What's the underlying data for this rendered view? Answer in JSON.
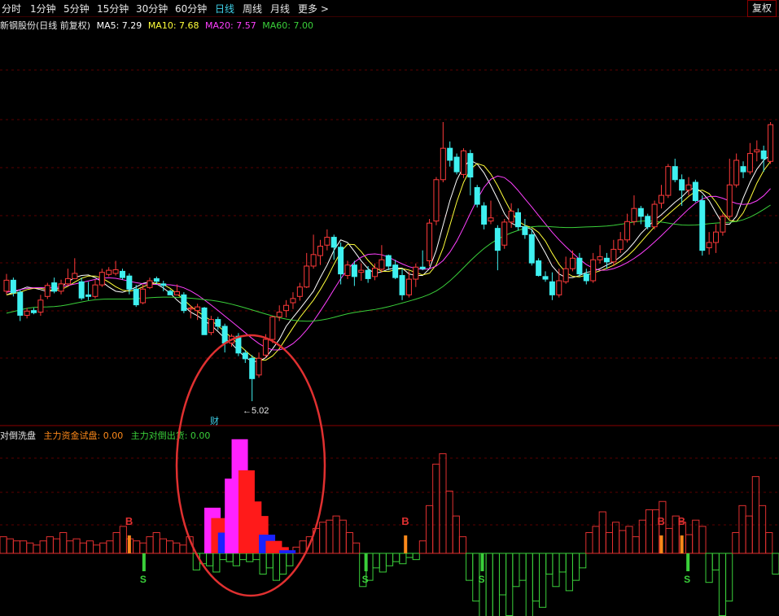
{
  "toolbar": {
    "tabs": [
      {
        "label": "分时"
      },
      {
        "label": "1分钟"
      },
      {
        "label": "5分钟"
      },
      {
        "label": "15分钟"
      },
      {
        "label": "30分钟"
      },
      {
        "label": "60分钟"
      },
      {
        "label": "日线"
      },
      {
        "label": "周线"
      },
      {
        "label": "月线"
      },
      {
        "label": "更多 >"
      }
    ],
    "active_tab": "日线",
    "adjust_button": "复权"
  },
  "main_chart": {
    "title": "新钢股份(日线 前复权)",
    "ma_legend": [
      {
        "label": "MA5: 7.29",
        "color": "#ffffff"
      },
      {
        "label": "MA10: 7.68",
        "color": "#ffff3a"
      },
      {
        "label": "MA20: 7.57",
        "color": "#ff40ff"
      },
      {
        "label": "MA60: 7.00",
        "color": "#3ad03a"
      }
    ],
    "low_marker": "5.02",
    "event_marker": "财"
  },
  "indicator": {
    "name": "对倒洗盘",
    "legend": [
      {
        "label": "主力资金试盘: 0.00",
        "color": "#ff8a1a"
      },
      {
        "label": "主力对倒出货: 0.00",
        "color": "#3ad03a"
      }
    ],
    "signal_buy": "B",
    "signal_sell": "S"
  },
  "colors": {
    "up": "#ff3a3a",
    "down": "#3ff0f0",
    "grid": "#5a0000",
    "annotation": "#e03030"
  },
  "candles": [
    [
      7.12,
      7.33,
      7.45,
      7.06
    ],
    [
      7.33,
      7.09,
      7.38,
      7.02
    ],
    [
      7.1,
      6.66,
      7.15,
      6.55
    ],
    [
      6.66,
      6.74,
      6.8,
      6.6
    ],
    [
      6.75,
      6.71,
      6.8,
      6.68
    ],
    [
      6.72,
      6.95,
      7.05,
      6.65
    ],
    [
      7.02,
      7.23,
      7.28,
      6.97
    ],
    [
      7.28,
      7.12,
      7.38,
      7.08
    ],
    [
      7.12,
      7.26,
      7.34,
      7.06
    ],
    [
      7.26,
      7.36,
      7.55,
      7.22
    ],
    [
      7.36,
      7.46,
      7.75,
      7.36
    ],
    [
      7.3,
      6.99,
      7.38,
      6.95
    ],
    [
      7.05,
      7.02,
      7.3,
      6.95
    ],
    [
      7.02,
      7.24,
      7.34,
      6.98
    ],
    [
      7.24,
      7.48,
      7.55,
      7.2
    ],
    [
      7.44,
      7.52,
      7.58,
      7.4
    ],
    [
      7.46,
      7.53,
      7.7,
      7.42
    ],
    [
      7.5,
      7.38,
      7.55,
      7.34
    ],
    [
      7.41,
      7.16,
      7.46,
      7.06
    ],
    [
      7.16,
      6.86,
      7.24,
      6.82
    ],
    [
      6.9,
      7.16,
      7.25,
      6.87
    ],
    [
      7.19,
      7.32,
      7.38,
      7.16
    ],
    [
      7.36,
      7.31,
      7.4,
      7.25
    ],
    [
      7.26,
      7.23,
      7.32,
      7.12
    ],
    [
      7.12,
      7.05,
      7.15,
      7.05
    ],
    [
      7.05,
      7.11,
      7.25,
      7.05
    ],
    [
      7.05,
      6.75,
      7.1,
      6.7
    ],
    [
      6.78,
      6.8,
      6.85,
      6.6
    ],
    [
      6.75,
      6.82,
      6.88,
      6.57
    ],
    [
      6.8,
      6.29,
      6.82,
      6.29
    ],
    [
      6.33,
      6.58,
      6.65,
      6.28
    ],
    [
      6.58,
      6.45,
      6.63,
      6.38
    ],
    [
      6.45,
      6.13,
      6.5,
      5.95
    ],
    [
      6.13,
      6.26,
      6.3,
      6.06
    ],
    [
      6.26,
      5.94,
      6.32,
      5.88
    ],
    [
      5.94,
      5.83,
      6.0,
      5.75
    ],
    [
      5.84,
      5.45,
      5.9,
      5.02
    ],
    [
      5.52,
      5.84,
      5.95,
      5.47
    ],
    [
      5.9,
      6.2,
      6.3,
      5.85
    ],
    [
      6.2,
      6.63,
      6.65,
      6.13
    ],
    [
      6.63,
      6.72,
      6.85,
      6.55
    ],
    [
      6.75,
      6.85,
      6.95,
      6.62
    ],
    [
      6.9,
      6.98,
      7.1,
      6.78
    ],
    [
      7.02,
      7.2,
      7.28,
      6.94
    ],
    [
      7.2,
      7.6,
      7.85,
      7.18
    ],
    [
      7.6,
      7.82,
      8.2,
      7.55
    ],
    [
      7.8,
      7.98,
      8.1,
      7.62
    ],
    [
      8.0,
      8.15,
      8.3,
      7.9
    ],
    [
      8.15,
      7.96,
      8.2,
      7.72
    ],
    [
      7.96,
      7.45,
      8.05,
      7.25
    ],
    [
      7.42,
      7.62,
      7.7,
      7.35
    ],
    [
      7.62,
      7.4,
      7.7,
      7.22
    ],
    [
      7.48,
      7.52,
      7.65,
      7.32
    ],
    [
      7.52,
      7.36,
      7.6,
      7.28
    ],
    [
      7.4,
      7.56,
      7.65,
      7.33
    ],
    [
      7.54,
      7.72,
      8.0,
      7.48
    ],
    [
      7.8,
      7.6,
      7.82,
      7.52
    ],
    [
      7.62,
      7.38,
      7.72,
      7.35
    ],
    [
      7.42,
      7.05,
      7.55,
      6.95
    ],
    [
      7.05,
      7.35,
      7.5,
      7.0
    ],
    [
      7.35,
      7.58,
      7.65,
      7.2
    ],
    [
      7.58,
      7.55,
      7.9,
      7.52
    ],
    [
      7.7,
      8.42,
      8.5,
      7.6
    ],
    [
      8.46,
      9.25,
      9.3,
      8.38
    ],
    [
      9.25,
      9.85,
      10.35,
      9.2
    ],
    [
      9.85,
      9.62,
      9.98,
      9.5
    ],
    [
      9.68,
      9.4,
      9.75,
      9.35
    ],
    [
      9.35,
      9.8,
      9.85,
      9.28
    ],
    [
      9.75,
      9.3,
      9.82,
      8.95
    ],
    [
      9.1,
      8.78,
      9.15,
      8.72
    ],
    [
      8.75,
      8.4,
      8.82,
      8.3
    ],
    [
      8.46,
      8.52,
      8.85,
      8.4
    ],
    [
      8.32,
      7.9,
      8.38,
      7.52
    ],
    [
      8.0,
      8.44,
      8.5,
      7.93
    ],
    [
      8.44,
      8.65,
      8.8,
      8.33
    ],
    [
      8.62,
      8.35,
      8.7,
      8.28
    ],
    [
      8.35,
      8.2,
      8.5,
      8.12
    ],
    [
      8.2,
      7.66,
      8.3,
      7.61
    ],
    [
      7.7,
      7.42,
      7.75,
      7.4
    ],
    [
      7.4,
      7.35,
      7.5,
      7.3
    ],
    [
      7.3,
      7.05,
      7.48,
      6.95
    ],
    [
      7.05,
      7.32,
      7.55,
      7.0
    ],
    [
      7.3,
      7.55,
      7.78,
      7.26
    ],
    [
      7.55,
      7.75,
      7.9,
      7.5
    ],
    [
      7.75,
      7.45,
      7.85,
      7.4
    ],
    [
      7.45,
      7.32,
      7.55,
      7.25
    ],
    [
      7.32,
      7.72,
      7.85,
      7.28
    ],
    [
      7.72,
      7.78,
      8.0,
      7.65
    ],
    [
      7.75,
      7.68,
      7.85,
      7.55
    ],
    [
      7.68,
      7.92,
      8.1,
      7.6
    ],
    [
      7.92,
      8.1,
      8.25,
      7.85
    ],
    [
      8.1,
      8.45,
      8.6,
      8.05
    ],
    [
      8.45,
      8.7,
      8.95,
      8.38
    ],
    [
      8.7,
      8.55,
      8.75,
      8.4
    ],
    [
      8.55,
      8.35,
      8.6,
      8.3
    ],
    [
      8.35,
      8.78,
      8.85,
      8.3
    ],
    [
      8.8,
      8.95,
      9.15,
      8.7
    ],
    [
      8.95,
      9.5,
      9.55,
      8.9
    ],
    [
      9.5,
      9.25,
      9.65,
      9.2
    ],
    [
      9.25,
      9.05,
      9.35,
      8.75
    ],
    [
      9.05,
      9.15,
      9.3,
      8.95
    ],
    [
      9.2,
      8.85,
      9.25,
      8.82
    ],
    [
      8.85,
      7.9,
      8.95,
      7.8
    ],
    [
      7.95,
      8.05,
      8.25,
      7.82
    ],
    [
      8.05,
      8.25,
      8.4,
      7.85
    ],
    [
      8.25,
      8.55,
      8.6,
      8.18
    ],
    [
      8.55,
      9.15,
      9.65,
      8.5
    ],
    [
      9.15,
      9.62,
      9.75,
      9.1
    ],
    [
      9.5,
      9.4,
      9.6,
      9.28
    ],
    [
      9.4,
      9.75,
      9.95,
      9.35
    ],
    [
      9.78,
      9.82,
      10.0,
      9.6
    ],
    [
      9.8,
      9.65,
      9.9,
      9.4
    ],
    [
      9.6,
      10.3,
      10.35,
      9.55
    ]
  ],
  "ma_values": {
    "ma5": [
      7.05,
      7.1,
      7.15,
      7.2,
      7.18,
      7.15,
      7.11,
      7.14,
      7.2,
      7.3,
      7.38,
      7.42,
      7.43,
      7.38,
      7.3,
      7.2,
      7.12,
      7.1,
      7.14,
      7.2,
      7.27,
      7.3,
      7.26,
      7.18,
      7.08,
      6.95,
      6.84,
      6.72,
      6.65,
      6.56,
      6.47,
      6.35,
      6.22,
      6.12,
      5.98,
      5.86,
      5.78,
      5.78,
      5.85,
      6.02,
      6.2,
      6.45,
      6.62,
      6.78,
      6.95,
      7.12,
      7.38,
      7.62,
      7.9,
      8.1,
      8.05,
      7.88,
      7.7,
      7.55,
      7.46,
      7.49,
      7.54,
      7.56,
      7.56,
      7.45,
      7.42,
      7.42,
      7.55,
      7.9,
      8.38,
      8.85,
      9.24,
      9.5,
      9.62,
      9.55,
      9.38,
      9.14,
      8.88,
      8.6,
      8.42,
      8.36,
      8.35,
      8.3,
      8.08,
      7.85,
      7.6,
      7.45,
      7.38,
      7.38,
      7.42,
      7.48,
      7.5,
      7.55,
      7.62,
      7.68,
      7.78,
      7.9,
      8.05,
      8.22,
      8.35,
      8.48,
      8.58,
      8.7,
      8.82,
      8.92,
      9.05,
      9.1,
      9.0,
      8.85,
      8.62,
      8.4,
      8.4,
      8.55,
      8.9,
      9.2,
      9.45,
      9.62,
      9.72
    ]
  },
  "indicator_bars": {
    "hollow": [
      0.8,
      0.7,
      0.6,
      0.6,
      0.5,
      0.4,
      0.6,
      0.8,
      0.7,
      1.0,
      0.6,
      0.7,
      0.5,
      0.6,
      0.4,
      0.5,
      0.6,
      1.0,
      1.3,
      0.7,
      0.6,
      0.5,
      0.8,
      1.0,
      0.7,
      0.6,
      0.5,
      0.4,
      0.8,
      -0.8,
      -0.5,
      -0.6,
      -0.9,
      -0.3,
      -0.4,
      -0.6,
      -0.3,
      -0.4,
      -0.3,
      -1.0,
      -0.7,
      -1.3,
      -1.0,
      -0.6,
      0.3,
      0.6,
      0.8,
      1.2,
      1.5,
      1.6,
      1.8,
      1.6,
      1.0,
      0.5,
      -1.6,
      -1.3,
      -0.7,
      -0.9,
      -0.6,
      -0.4,
      -0.5,
      -0.2,
      -0.3,
      0.6,
      2.3,
      4.3,
      4.8,
      3.0,
      1.8,
      0.8,
      -1.3,
      -2.3,
      -3.3,
      -4.4,
      -3.6,
      -2.0,
      -3.0,
      -1.6,
      -1.3,
      -3.6,
      -2.3,
      -2.6,
      -1.0,
      -1.6,
      -0.9,
      -1.8,
      -1.3,
      -0.7,
      1.0,
      1.3,
      2.0,
      1.0,
      1.5,
      1.1,
      1.3,
      0.8,
      1.6,
      2.1,
      2.1,
      2.5,
      1.2,
      1.8,
      1.5,
      0.9,
      1.6,
      1.3,
      -1.4,
      -0.8,
      -3.0,
      -2.3,
      1.0,
      2.3,
      1.8,
      3.7,
      2.3,
      1.0,
      -1.0
    ]
  },
  "indicator_solid": [
    {
      "i": 20,
      "v": 2.2,
      "c": "m"
    },
    {
      "i": 21,
      "v": 1.7,
      "c": "r"
    },
    {
      "i": 22,
      "v": 1.0,
      "c": "b"
    },
    {
      "i": 23,
      "v": 3.6,
      "c": "m"
    },
    {
      "i": 24,
      "v": 5.5,
      "c": "m"
    },
    {
      "i": 25,
      "v": 4.0,
      "c": "r"
    },
    {
      "i": 26,
      "v": 2.5,
      "c": "r"
    },
    {
      "i": 27,
      "v": 1.8,
      "c": "r"
    },
    {
      "i": 28,
      "v": 0.9,
      "c": "b"
    },
    {
      "i": 29,
      "v": 0.6,
      "c": "r"
    },
    {
      "i": 30,
      "v": 0.3,
      "c": "r"
    },
    {
      "i": 31,
      "v": 0.15,
      "c": "b"
    }
  ],
  "buy_signals": [
    12,
    39,
    56,
    58,
    75
  ],
  "sell_signals": [
    13,
    34,
    45,
    58,
    70
  ]
}
